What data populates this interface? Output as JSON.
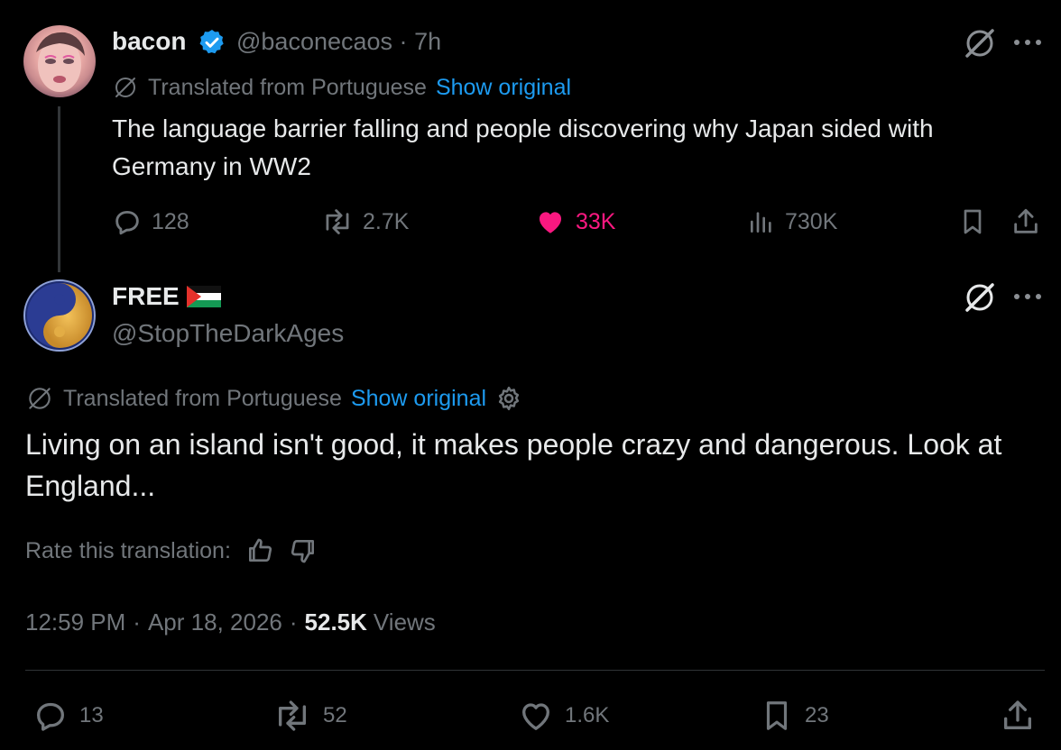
{
  "parent_tweet": {
    "display_name": "bacon",
    "handle": "@baconecaos",
    "time_separator": "·",
    "age": "7h",
    "translated_label": "Translated from Portuguese",
    "show_original": "Show original",
    "text": "The language barrier falling and people discovering why Japan sided with Germany in WW2",
    "replies": "128",
    "reposts": "2.7K",
    "likes": "33K",
    "views": "730K"
  },
  "main_tweet": {
    "display_name": "FREE",
    "flag_emoji": "🇵🇸",
    "handle": "@StopTheDarkAges",
    "translated_label": "Translated from Portuguese",
    "show_original": "Show original",
    "text": "Living on an island isn't good, it makes people crazy and dangerous. Look at England...",
    "rate_label": "Rate this translation:",
    "time": "12:59 PM",
    "sep1": "·",
    "date": "Apr 18, 2026",
    "sep2": "·",
    "views_count": "52.5K",
    "views_label": "Views",
    "replies": "13",
    "reposts": "52",
    "likes": "1.6K",
    "bookmarks": "23"
  },
  "colors": {
    "background": "#000000",
    "text_primary": "#e7e9ea",
    "text_secondary": "#71767b",
    "link_blue": "#1d9bf0",
    "like_pink": "#f91880",
    "verified_blue": "#1d9bf0"
  },
  "icons": {
    "grok": "grok-icon",
    "more": "more-icon",
    "reply": "reply-icon",
    "repost": "repost-icon",
    "like": "heart-icon",
    "views": "views-icon",
    "bookmark": "bookmark-icon",
    "share": "share-icon",
    "translate": "translate-icon",
    "settings": "gear-icon",
    "thumbs_up": "thumbs-up-icon",
    "thumbs_down": "thumbs-down-icon",
    "verified": "verified-badge-icon"
  }
}
